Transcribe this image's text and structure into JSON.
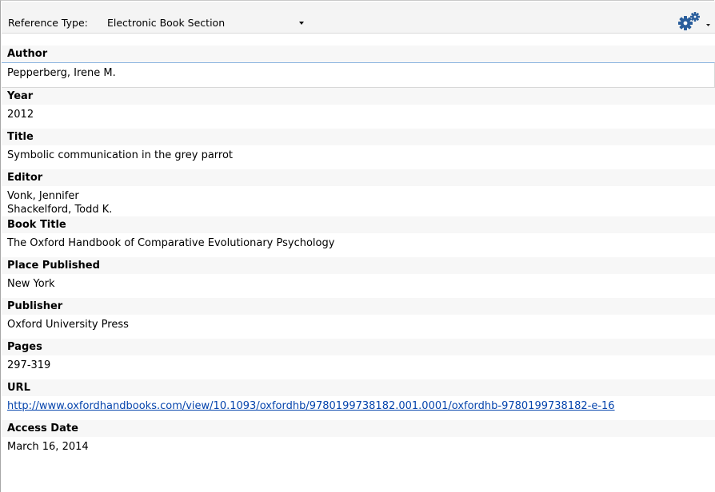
{
  "reference_type": {
    "label": "Reference Type:",
    "selected": "Electronic Book Section"
  },
  "toolbar": {
    "options_icon": "gears-icon"
  },
  "fields": [
    {
      "label": "Author",
      "values": [
        "Pepperberg, Irene M."
      ]
    },
    {
      "label": "Year",
      "values": [
        "2012"
      ]
    },
    {
      "label": "Title",
      "values": [
        "Symbolic communication in the grey parrot"
      ]
    },
    {
      "label": "Editor",
      "values": [
        "Vonk, Jennifer",
        "Shackelford, Todd K."
      ]
    },
    {
      "label": "Book Title",
      "values": [
        "The Oxford Handbook of Comparative Evolutionary Psychology"
      ]
    },
    {
      "label": "Place Published",
      "values": [
        "New York"
      ]
    },
    {
      "label": "Publisher",
      "values": [
        "Oxford University Press"
      ]
    },
    {
      "label": "Pages",
      "values": [
        "297-319"
      ]
    },
    {
      "label": "URL",
      "values": [
        "http://www.oxfordhandbooks.com/view/10.1093/oxfordhb/9780199738182.001.0001/oxfordhb-9780199738182-e-16"
      ]
    },
    {
      "label": "Access Date",
      "values": [
        "March 16, 2014"
      ]
    }
  ],
  "colors": {
    "toolbar_bg": "#f4f4f4",
    "label_bg": "#f7f7f7",
    "link": "#0645ad",
    "gear": "#2a5e9c"
  }
}
